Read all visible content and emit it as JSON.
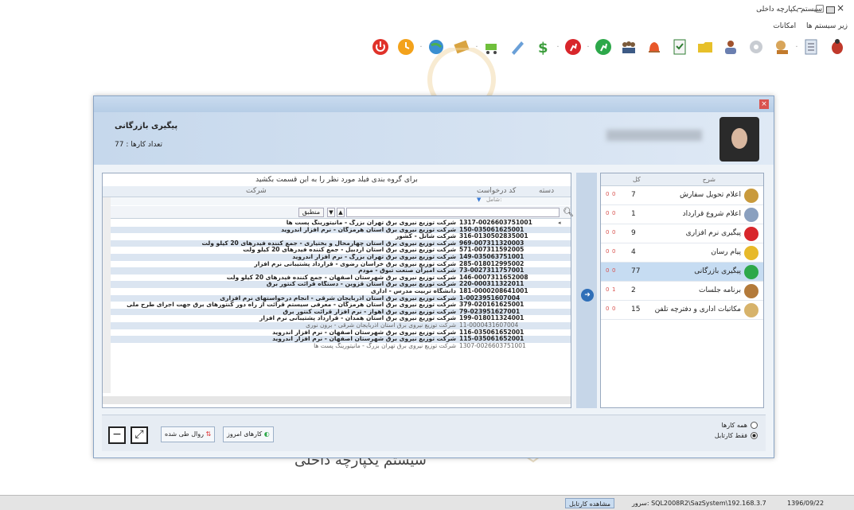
{
  "window": {
    "title": "سیستم یکپارچه داخلی",
    "minimize": "–",
    "maximize": "□",
    "close": "×"
  },
  "menu": {
    "items": [
      "زیر سیستم ها",
      "امکانات"
    ]
  },
  "toolbar": {
    "icons": [
      "bug-icon",
      "list-icon",
      "tools-icon",
      "settings-icon",
      "user-icon",
      "folder-icon",
      "checklist-icon",
      "bell-icon",
      "team-icon",
      "green-runner-icon",
      "red-runner-icon",
      "dollar-icon",
      "pen-icon",
      "cart-icon",
      "tape-icon",
      "globe-icon",
      "clock-icon",
      "power-icon"
    ],
    "colors": {
      "power": "#e0322a",
      "clock": "#f3a21b",
      "green": "#2da84a",
      "red": "#d8262b",
      "dollar": "#3b9d3b"
    }
  },
  "background": {
    "logo_text": "سیستم یکپارچه داخلی"
  },
  "dialog": {
    "close": "×",
    "header": {
      "title": "پیگیری بازرگانی",
      "count_label": "تعداد کارها : 77"
    },
    "grid": {
      "group_hint": "برای گروه بندی فیلد مورد نظر را به این قسمت بکشید",
      "columns": {
        "category": "دسته",
        "request_code": "کد درخواست",
        "company": "شرکت"
      },
      "filter_label": "شامل:",
      "search": {
        "value": "",
        "match_label": "منطبق",
        "up": "▲",
        "down": "▼"
      },
      "rows": [
        {
          "code": "1317-0026603751001",
          "company": "شرکت توزیع نیروی برق تهران بزرگ - مانیتورینگ پست ها",
          "dim": false
        },
        {
          "code": "150-035061625001",
          "company": "شرکت توزیع نیروی برق استان هرمزگان - نرم افزار اندروید",
          "dim": false
        },
        {
          "code": "316-0130502835001",
          "company": "شرکت شاتل - کشور",
          "dim": false
        },
        {
          "code": "969-007311320003",
          "company": "شرکت توزیع نیروی برق استان چهارمحال و بختیاری - جمع کننده فیدرهای 20 کیلو ولت",
          "dim": false
        },
        {
          "code": "571-007311592005",
          "company": "شرکت توزیع نیروی برق استان اردبیل - جمع کننده فیدرهای 20 کیلو ولت",
          "dim": false
        },
        {
          "code": "149-035063751001",
          "company": "شرکت توزیع نیروی برق تهران بزرگ - نرم افزار اندروید",
          "dim": false
        },
        {
          "code": "285-018012995002",
          "company": "شرکت توزیع نیروی برق خراسان رضوی - قرارداد پشتیبانی نرم افزار",
          "dim": false
        },
        {
          "code": "73-0027311757001",
          "company": "شرکت امیران صنعت تبوق - مودم",
          "dim": false
        },
        {
          "code": "146-0007311652008",
          "company": "شرکت توزیع نیروی برق شهرستان اصفهان - جمع کننده فیدرهای 20 کیلو ولت",
          "dim": false
        },
        {
          "code": "220-000311322011",
          "company": "شرکت توزیع نیروی برق استان قزوین - دستگاه قرائت کنتور برق",
          "dim": false
        },
        {
          "code": "181-0000208641001",
          "company": "دانشگاه تربیت مدرس - اداری",
          "dim": false
        },
        {
          "code": "1-0023951607004",
          "company": "شرکت توزیع نیروی برق استان آذربایجان شرقی - انجام درخواستهای نرم افزاری",
          "dim": false
        },
        {
          "code": "379-020161625001",
          "company": "شرکت توزیع نیروی برق استان هرمزگان - معرفی سیستم قرائت از راه دور کنتورهای برق جهت اجرای طرح ملی",
          "dim": false
        },
        {
          "code": "79-023951627001",
          "company": "شرکت توزیع نیروی برق اهواز - نرم افزار قرائت کنتور برق",
          "dim": false
        },
        {
          "code": "199-018011324001",
          "company": "شرکت توزیع نیروی برق استان همدان - قرارداد پشتیبانی نرم افزار",
          "dim": false
        },
        {
          "code": "11-0000431607004",
          "company": "شرکت توزیع نیروی برق استان آذربایجان شرقی - برون نوری",
          "dim": true
        },
        {
          "code": "116-035061652001",
          "company": "شرکت توزیع نیروی برق شهرستان اصفهان - نرم افزار اندروید",
          "dim": false
        },
        {
          "code": "115-035061652001",
          "company": "شرکت توزیع نیروی برق شهرستان اصفهان - نرم افزار اندروید",
          "dim": false
        },
        {
          "code": "1307-0026603751001",
          "company": "شرکت توزیع نیروی برق تهران بزرگ - مانیتورینگ پست ها",
          "dim": true
        }
      ]
    },
    "list": {
      "columns": {
        "title": "شرح",
        "total": "کل"
      },
      "items": [
        {
          "label": "اعلام تحویل سفارش",
          "count": "7",
          "z1": "0",
          "z2": "0",
          "icon": "hand-box-icon",
          "color": "#c99a3c",
          "selected": false
        },
        {
          "label": "اعلام شروع قرارداد",
          "count": "1",
          "z1": "0",
          "z2": "0",
          "icon": "document-icon",
          "color": "#8aa0bf",
          "selected": false
        },
        {
          "label": "پیگیری نرم افزاری",
          "count": "9",
          "z1": "0",
          "z2": "0",
          "icon": "red-runner-icon",
          "color": "#d8262b",
          "selected": false
        },
        {
          "label": "پیام رسان",
          "count": "4",
          "z1": "0",
          "z2": "0",
          "icon": "folder-icon",
          "color": "#e7b92a",
          "selected": false
        },
        {
          "label": "پیگیری بازرگانی",
          "count": "77",
          "z1": "0",
          "z2": "0",
          "icon": "green-runner-icon",
          "color": "#2da84a",
          "selected": true
        },
        {
          "label": "برنامه جلسات",
          "count": "2",
          "z1": "0",
          "z2": "1",
          "icon": "team-icon",
          "color": "#b37a3a",
          "selected": false
        },
        {
          "label": "مکاتبات اداری و دفترچه تلفن",
          "count": "15",
          "z1": "0",
          "z2": "0",
          "icon": "mail-icon",
          "color": "#d7b36b",
          "selected": false
        }
      ]
    },
    "bottom": {
      "today_label": "کارهای امروز",
      "history_label": "روال طی شده",
      "radio_all": "همه کارها",
      "radio_user": "فقط کارتابل"
    }
  },
  "statusbar": {
    "date": "1396/09/22",
    "server": "سرور: SQL2008R2\\SazSystem\\192.168.3.7",
    "view_link": "مشاهده کارتابل"
  }
}
